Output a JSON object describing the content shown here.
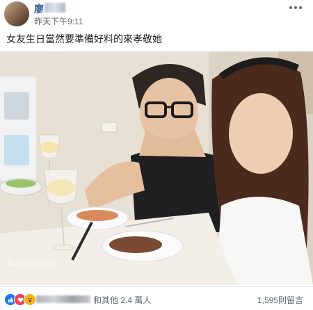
{
  "post": {
    "author_name": "廖",
    "timestamp": "昨天下午9:11",
    "caption": "女友生日當然要準備好料的來孝敬她"
  },
  "photo": {
    "description_icon": "photo",
    "watermark": "BeautyCam"
  },
  "footer": {
    "reactions": [
      "like-icon",
      "love-icon",
      "wow-icon"
    ],
    "reaction_text": "和其他 2.4 萬人",
    "comments_count": "1,595則留言"
  },
  "colors": {
    "link": "#365899",
    "meta": "#616770",
    "like": "#1877f2",
    "love": "#f33e58",
    "wow": "#f7b125"
  }
}
